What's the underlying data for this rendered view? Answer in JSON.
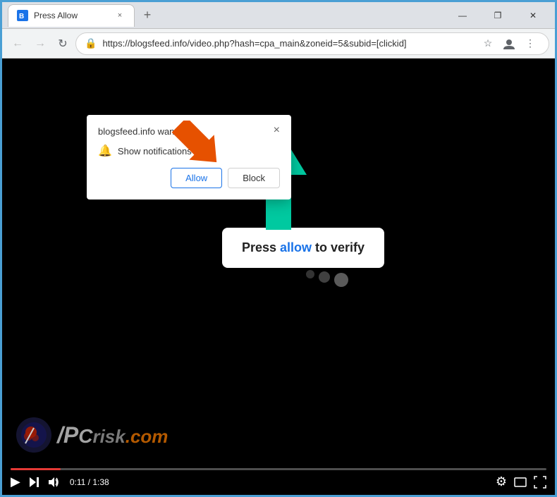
{
  "browser": {
    "tab": {
      "favicon_color": "#1565c0",
      "title": "Press Allow",
      "close_label": "×"
    },
    "new_tab_label": "+",
    "window_controls": {
      "minimize": "—",
      "maximize": "❐",
      "close": "✕"
    },
    "nav": {
      "back_label": "←",
      "forward_label": "→",
      "reload_label": "↻",
      "url": "https://blogsfeed.info/video.php?hash=cpa_main&zoneid=5&subid=[clickid]",
      "star_icon": "☆",
      "profile_icon": "◉",
      "menu_icon": "⋮"
    }
  },
  "notification_popup": {
    "title": "blogsfeed.info wants to",
    "close_label": "×",
    "bell_icon": "🔔",
    "notification_text": "Show notifications",
    "allow_label": "Allow",
    "block_label": "Block"
  },
  "main_content": {
    "verify_text_prefix": "Press ",
    "verify_allow": "allow",
    "verify_text_suffix": " to verify",
    "loading_dots": [
      {
        "size": 12,
        "opacity": 0.4
      },
      {
        "size": 16,
        "opacity": 0.5
      },
      {
        "size": 20,
        "opacity": 0.7
      }
    ]
  },
  "video_controls": {
    "play_icon": "▶",
    "skip_icon": "⏭",
    "volume_icon": "🔊",
    "time_current": "0:11",
    "time_total": "1:38",
    "settings_icon": "⚙",
    "theater_icon": "▭",
    "fullscreen_icon": "⛶",
    "progress_percent": 9.3
  },
  "pcrisk": {
    "text_pc": "/PC",
    "text_risk": "risk",
    "text_com": ".com"
  }
}
